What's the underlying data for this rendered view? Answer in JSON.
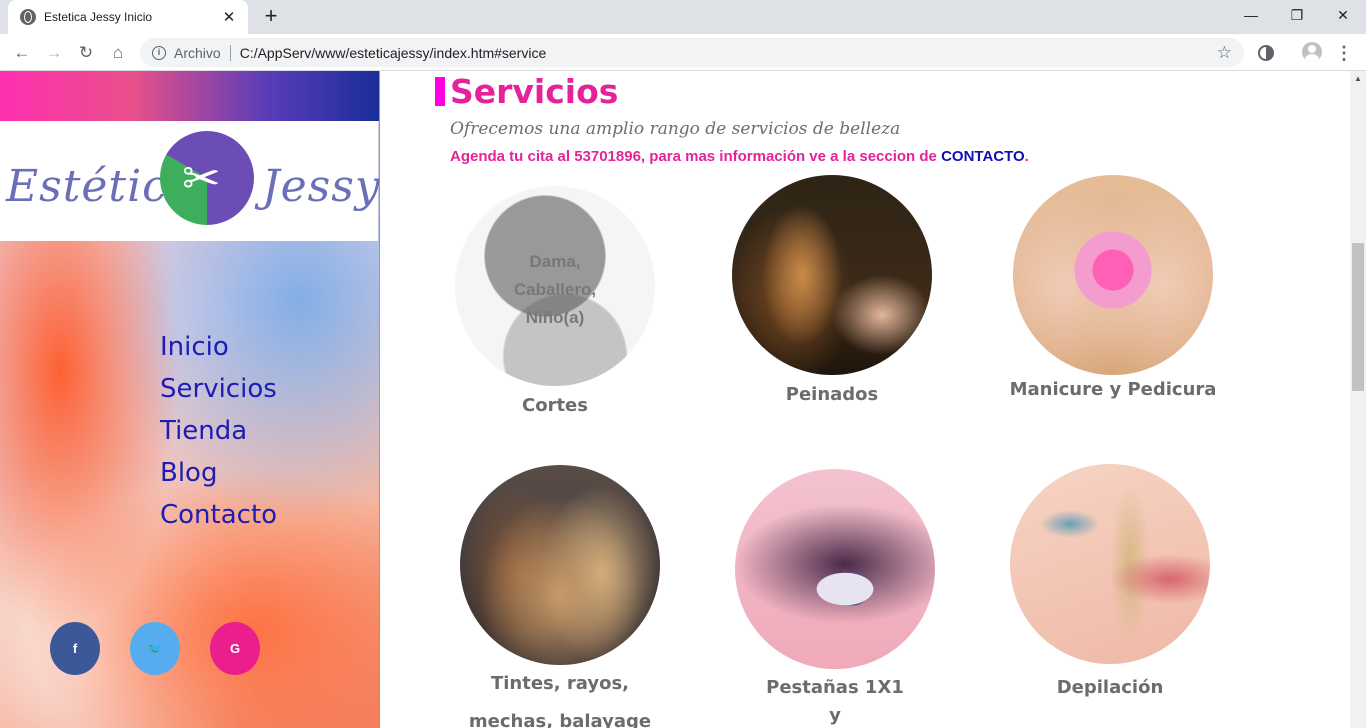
{
  "browser": {
    "tab_title": "Estetica Jessy Inicio",
    "tab_close": "✕",
    "new_tab": "+",
    "scheme": "Archivo",
    "url": "C:/AppServ/www/esteticajessy/index.htm#service",
    "window_minimize": "—",
    "window_restore": "❐",
    "window_close": "✕"
  },
  "logo": {
    "left_text": "Estética",
    "right_text": "Jessy"
  },
  "nav": {
    "items": [
      "Inicio",
      "Servicios",
      "Tienda",
      "Blog",
      "Contacto"
    ]
  },
  "social": {
    "facebook": "f",
    "twitter": "🐦",
    "google": "G",
    "colors": {
      "facebook": "#3b5998",
      "twitter": "#55acee",
      "google": "#ea1e8c"
    }
  },
  "services": {
    "title": "Servicios",
    "subtitle": "Ofrecemos una amplio rango de servicios de belleza",
    "agenda_text": "Agenda tu cita al 53701896, para mas información ve a la seccion de ",
    "contact_link": "CONTACTO",
    "agenda_end": ".",
    "cortes_overlay": [
      "Dama,",
      "Caballero,",
      "Niño(a)"
    ],
    "items": [
      {
        "label": "Cortes"
      },
      {
        "label": "Peinados"
      },
      {
        "label": "Manicure y Pedicura"
      },
      {
        "label": "Tintes, rayos,",
        "label2": "mechas, balayage"
      },
      {
        "label": "Pestañas 1X1",
        "label2": "y"
      },
      {
        "label": "Depilación"
      }
    ]
  },
  "colors": {
    "accent_pink": "#e6229b",
    "nav_blue": "#1d1db3",
    "title_bar": "#ff00e6"
  }
}
